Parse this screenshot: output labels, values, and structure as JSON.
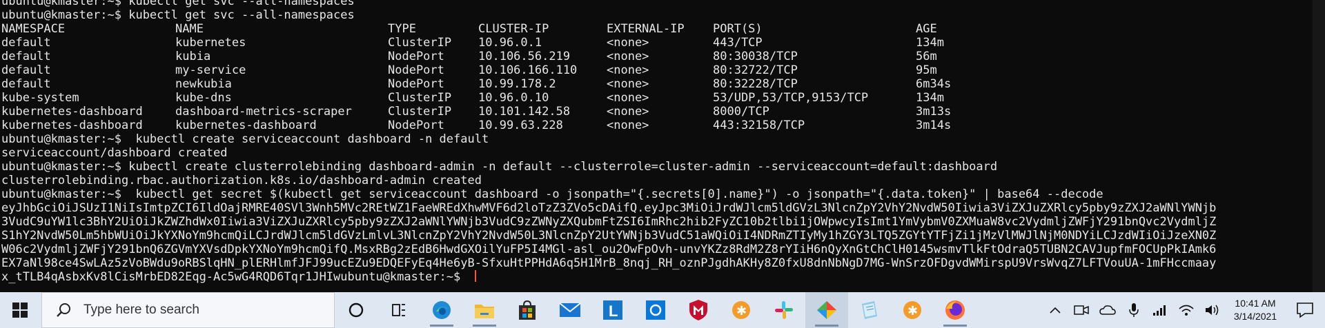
{
  "terminal": {
    "line0": "ubuntu@kmaster:~$ kubectl get svc --all-namespaces",
    "line1": "ubuntu@kmaster:~$ kubectl get svc --all-namespaces",
    "table_header": [
      "NAMESPACE",
      "NAME",
      "TYPE",
      "CLUSTER-IP",
      "EXTERNAL-IP",
      "PORT(S)",
      "AGE"
    ],
    "table_rows": [
      [
        "default",
        "kubernetes",
        "ClusterIP",
        "10.96.0.1",
        "<none>",
        "443/TCP",
        "134m"
      ],
      [
        "default",
        "kubia",
        "NodePort",
        "10.106.56.219",
        "<none>",
        "80:30038/TCP",
        "56m"
      ],
      [
        "default",
        "my-service",
        "NodePort",
        "10.106.166.110",
        "<none>",
        "80:32722/TCP",
        "95m"
      ],
      [
        "default",
        "newkubia",
        "NodePort",
        "10.99.178.2",
        "<none>",
        "80:32228/TCP",
        "6m34s"
      ],
      [
        "kube-system",
        "kube-dns",
        "ClusterIP",
        "10.96.0.10",
        "<none>",
        "53/UDP,53/TCP,9153/TCP",
        "134m"
      ],
      [
        "kubernetes-dashboard",
        "dashboard-metrics-scraper",
        "ClusterIP",
        "10.101.142.58",
        "<none>",
        "8000/TCP",
        "3m13s"
      ],
      [
        "kubernetes-dashboard",
        "kubernetes-dashboard",
        "NodePort",
        "10.99.63.228",
        "<none>",
        "443:32158/TCP",
        "3m14s"
      ]
    ],
    "line10": "ubuntu@kmaster:~$  kubectl create serviceaccount dashboard -n default",
    "line11": "serviceaccount/dashboard created",
    "line12": "ubuntu@kmaster:~$ kubectl create clusterrolebinding dashboard-admin -n default --clusterrole=cluster-admin --serviceaccount=default:dashboard",
    "line13": "clusterrolebinding.rbac.authorization.k8s.io/dashboard-admin created",
    "line14": "ubuntu@kmaster:~$  kubectl get secret $(kubectl get serviceaccount dashboard -o jsonpath=\"{.secrets[0].name}\") -o jsonpath=\"{.data.token}\" | base64 --decode",
    "line15": "eyJhbGciOiJSUzI1NiIsImtpZCI6IldOajRMRE40SVl3Wnh5MVc2REtWZ1FaeWREdXhwMVF6d2loTzZ3ZVo5cDAifQ.eyJpc3MiOiJrdWJlcm5ldGVzL3NlcnZpY2VhY2NvdW50Iiwia3ViZXJuZXRlcy5pby9zZXJ2aWNlYWNjb",
    "line16": "3VudC9uYW1lc3BhY2UiOiJkZWZhdWx0Iiwia3ViZXJuZXRlcy5pby9zZXJ2aWNlYWNjb3VudC9zZWNyZXQubmFtZSI6ImRhc2hib2FyZC10b2tlbi1jOWpwcyIsImt1YmVybmV0ZXMuaW8vc2VydmljZWFjY291bnQvc2VydmljZ",
    "line17": "S1hY2NvdW50Lm5hbWUiOiJkYXNoYm9hcmQiLCJrdWJlcm5ldGVzLmlvL3NlcnZpY2VhY2NvdW50L3NlcnZpY2UtYWNjb3VudC51aWQiOiI4NDRmZTIyMy1hZGY3LTQ5ZGYtYTFjZi1jMzVlMWJlNjM0NDYiLCJzdWIiOiJzeXN0Z",
    "line18": "W06c2VydmljZWFjY291bnQ6ZGVmYXVsdDpkYXNoYm9hcmQifQ.MsxRBg2zEdB6HwdGXOilYuFP5I4MGl-asl_ou2OwFpOvh-unvYKZz8RdM2Z8rYIiH6nQyXnGtChClH0145wsmvTlkFtOdraQ5TUBN2CAVJupfmFOCUpPkIAmk6",
    "line19": "EX7aNl98ce4SwLAz5zVoBWdu9oRBSlqHN_plERHlmfJFJ99ucEZu9EDQEFyEq4He6yB-SfxuHtPPHdA6q5H1MrB_8nqj_RH_oznPJgdhAKHy8Z0fxU8dnNbNgD7MG-WnSrzOFDgvdWMirspU9VrsWvqZ7LFTVouUA-1mFHccmaay",
    "line20": "x_tTLB4qAsbxKv8lCisMrbED82Eqg-Ac5wG4RQD6Tqr1JHIwubuntu@kmaster:~$ "
  },
  "taskbar": {
    "search_placeholder": "Type here to search",
    "pinned_apps": [
      "cortana-icon",
      "task-view-icon",
      "edge-icon",
      "file-explorer-icon",
      "store-icon",
      "mail-icon",
      "l-app-icon",
      "blue-app-icon",
      "mcafee-icon",
      "orange-app-icon",
      "slack-icon",
      "colorful-app-icon",
      "notepad-icon",
      "orange-app-2-icon",
      "firefox-icon"
    ],
    "clock_time": "10:41 AM",
    "clock_date": "3/14/2021"
  },
  "colors": {
    "terminal_bg": "#0c0c0c",
    "terminal_text": "#e6e6e6",
    "cursor": "#ff5a1f",
    "taskbar_bg": "#dfe7f2"
  }
}
